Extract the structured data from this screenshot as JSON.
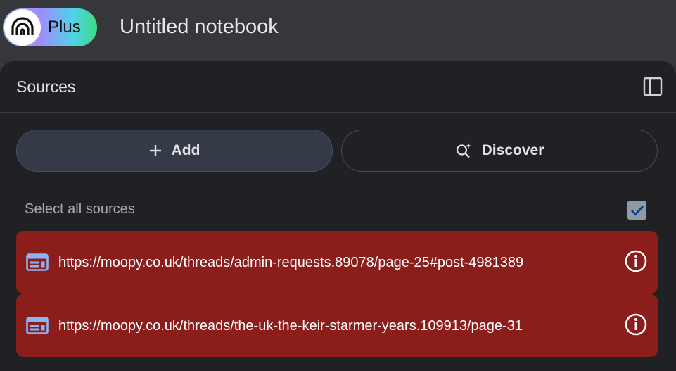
{
  "header": {
    "plan_badge": "Plus",
    "logo_icon": "notebooklm-logo-icon",
    "notebook_title": "Untitled notebook"
  },
  "sources_panel": {
    "title": "Sources",
    "collapse_icon": "panel-collapse-icon",
    "add_button": {
      "label": "Add",
      "icon": "plus-icon"
    },
    "discover_button": {
      "label": "Discover",
      "icon": "discover-sparkle-search-icon"
    },
    "select_all_label": "Select all sources",
    "select_all_checked": true,
    "sources": [
      {
        "url": "https://moopy.co.uk/threads/admin-requests.89078/page-25#post-4981389",
        "icon": "web-source-icon",
        "status_icon": "info-icon",
        "status_color": "#8b1e1b"
      },
      {
        "url": "https://moopy.co.uk/threads/the-uk-the-keir-starmer-years.109913/page-31",
        "icon": "web-source-icon",
        "status_icon": "info-icon",
        "status_color": "#8b1e1b"
      }
    ]
  },
  "colors": {
    "background": "#36373a",
    "panel": "#1f2124",
    "source_error": "#8b1e1b",
    "accent_blue": "#8ab4f8"
  }
}
